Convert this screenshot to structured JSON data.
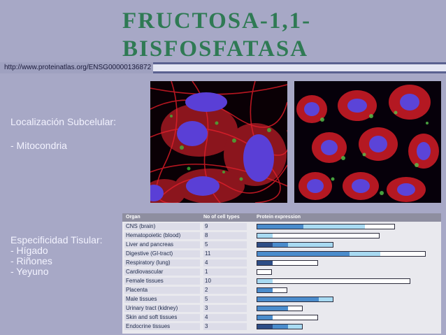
{
  "slide": {
    "title": "FRUCTOSA-1,1-BISFOSFATASA",
    "url": "http://www.proteinatlas.org/ENSG00000136872",
    "localization_heading": "Localización Subcelular:",
    "localization_item": "- Mitocondria",
    "specificity_heading": "Especificidad Tisular:",
    "specificity_items": [
      "- Hígado",
      "- Riñones",
      "- Yeyuno"
    ]
  },
  "table": {
    "headers": {
      "organ": "Organ",
      "count": "No of cell types",
      "expression": "Protein expression"
    },
    "legend_colors": {
      "high": "#2d4d86",
      "medium": "#4a8ccc",
      "low": "#a8daf2",
      "none": "#ffffff"
    },
    "rows": [
      {
        "organ": "CNS (brain)",
        "count": "9",
        "segments": {
          "high": 0,
          "medium": 3,
          "low": 4,
          "none": 2
        }
      },
      {
        "organ": "Hematopoietic (blood)",
        "count": "8",
        "segments": {
          "high": 0,
          "medium": 0,
          "low": 1,
          "none": 7
        }
      },
      {
        "organ": "Liver and pancreas",
        "count": "5",
        "segments": {
          "high": 1,
          "medium": 1,
          "low": 3,
          "none": 0
        }
      },
      {
        "organ": "Digestive (GI-tract)",
        "count": "11",
        "segments": {
          "high": 0,
          "medium": 6,
          "low": 2,
          "none": 3
        }
      },
      {
        "organ": "Respiratory (lung)",
        "count": "4",
        "segments": {
          "high": 1,
          "medium": 0,
          "low": 0,
          "none": 3
        }
      },
      {
        "organ": "Cardiovascular",
        "count": "1",
        "segments": {
          "high": 0,
          "medium": 0,
          "low": 0,
          "none": 1
        }
      },
      {
        "organ": "Female tissues",
        "count": "10",
        "segments": {
          "high": 0,
          "medium": 0,
          "low": 1,
          "none": 9
        }
      },
      {
        "organ": "Placenta",
        "count": "2",
        "segments": {
          "high": 0,
          "medium": 1,
          "low": 0,
          "none": 1
        }
      },
      {
        "organ": "Male tissues",
        "count": "5",
        "segments": {
          "high": 0,
          "medium": 4,
          "low": 1,
          "none": 0
        }
      },
      {
        "organ": "Urinary tract (kidney)",
        "count": "3",
        "segments": {
          "high": 0,
          "medium": 2,
          "low": 0,
          "none": 1
        }
      },
      {
        "organ": "Skin and soft tissues",
        "count": "4",
        "segments": {
          "high": 0,
          "medium": 1,
          "low": 0,
          "none": 3
        }
      },
      {
        "organ": "Endocrine tissues",
        "count": "3",
        "segments": {
          "high": 1,
          "medium": 1,
          "low": 1,
          "none": 0
        }
      }
    ]
  }
}
